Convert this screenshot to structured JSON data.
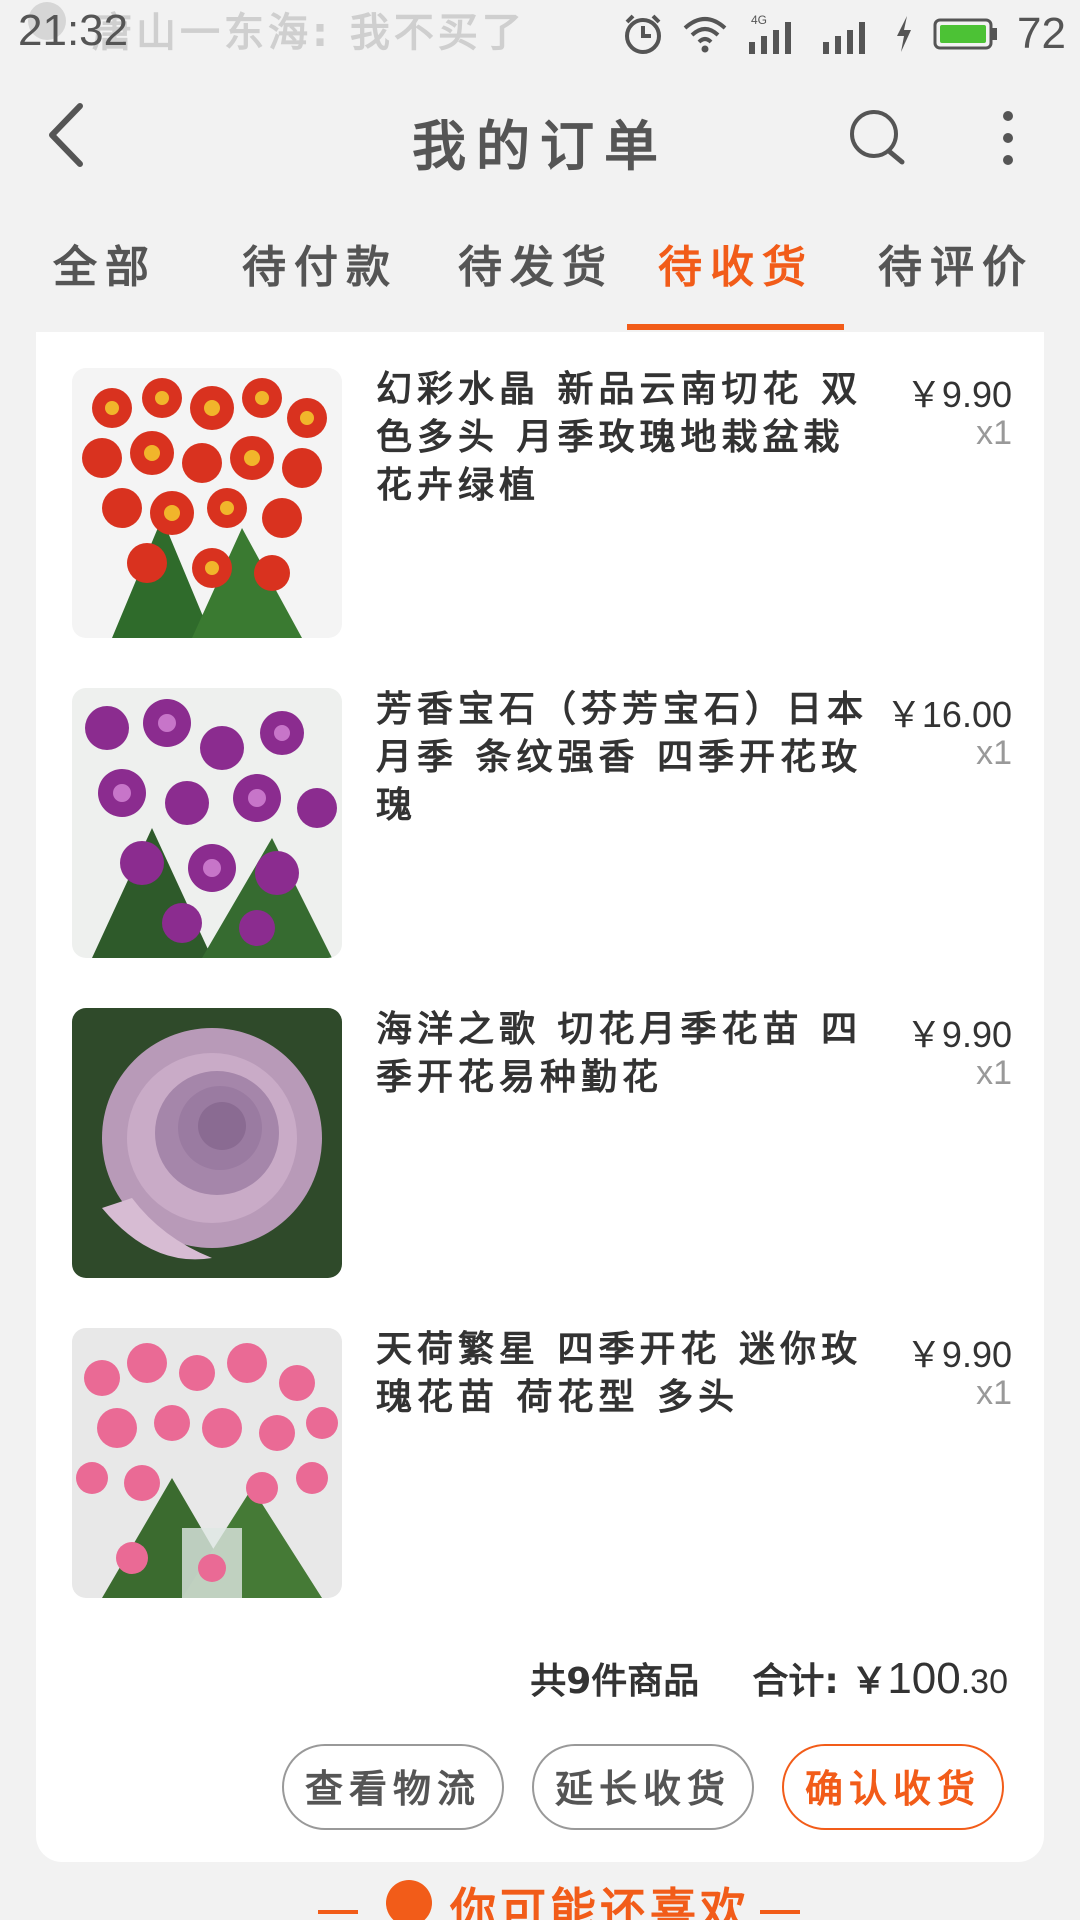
{
  "status_bar": {
    "time": "21:32",
    "notification": "唐山一东海: 我不买了",
    "battery": "72"
  },
  "header": {
    "title": "我的订单"
  },
  "tabs": [
    {
      "label": "全部"
    },
    {
      "label": "待付款"
    },
    {
      "label": "待发货"
    },
    {
      "label": "待收货",
      "active": true
    },
    {
      "label": "待评价"
    }
  ],
  "order": {
    "items": [
      {
        "title": "幻彩水晶 新品云南切花 双色多头 月季玫瑰地栽盆栽花卉绿植",
        "price": "￥9.90",
        "qty": "x1"
      },
      {
        "title": "芳香宝石（芬芳宝石）日本月季 条纹强香 四季开花玫瑰",
        "price": "￥16.00",
        "qty": "x1"
      },
      {
        "title": "海洋之歌 切花月季花苗 四季开花易种勤花",
        "price": "￥9.90",
        "qty": "x1"
      },
      {
        "title": "天荷繁星 四季开花 迷你玫瑰花苗 荷花型 多头",
        "price": "￥9.90",
        "qty": "x1"
      }
    ],
    "summary_count": "共9件商品",
    "summary_total_label": "合计:",
    "summary_currency": "￥",
    "summary_total_int": "100",
    "summary_total_dec": ".30"
  },
  "actions": {
    "logistics": "查看物流",
    "extend": "延长收货",
    "confirm": "确认收货"
  },
  "recommend": {
    "label": "你可能还喜欢"
  },
  "colors": {
    "accent": "#f25c19",
    "background": "#f2f2f2"
  }
}
